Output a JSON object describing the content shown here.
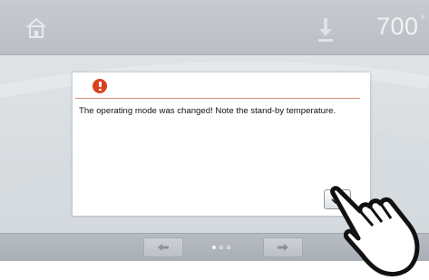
{
  "header": {
    "home_icon": "home-icon",
    "arrow_icon": "arrow-down-icon",
    "temperature_value": "700",
    "temperature_unit": "°"
  },
  "dialog": {
    "icon": "alert-icon",
    "message": "The operating mode was changed! Note the stand-by temperature.",
    "confirm_icon": "checkmark-icon"
  },
  "footer": {
    "prev_icon": "arrow-left-icon",
    "next_icon": "arrow-right-icon",
    "pages": {
      "current": 1,
      "total": 3
    }
  },
  "colors": {
    "alert": "#d9411e",
    "background": "#e3e6e9"
  }
}
